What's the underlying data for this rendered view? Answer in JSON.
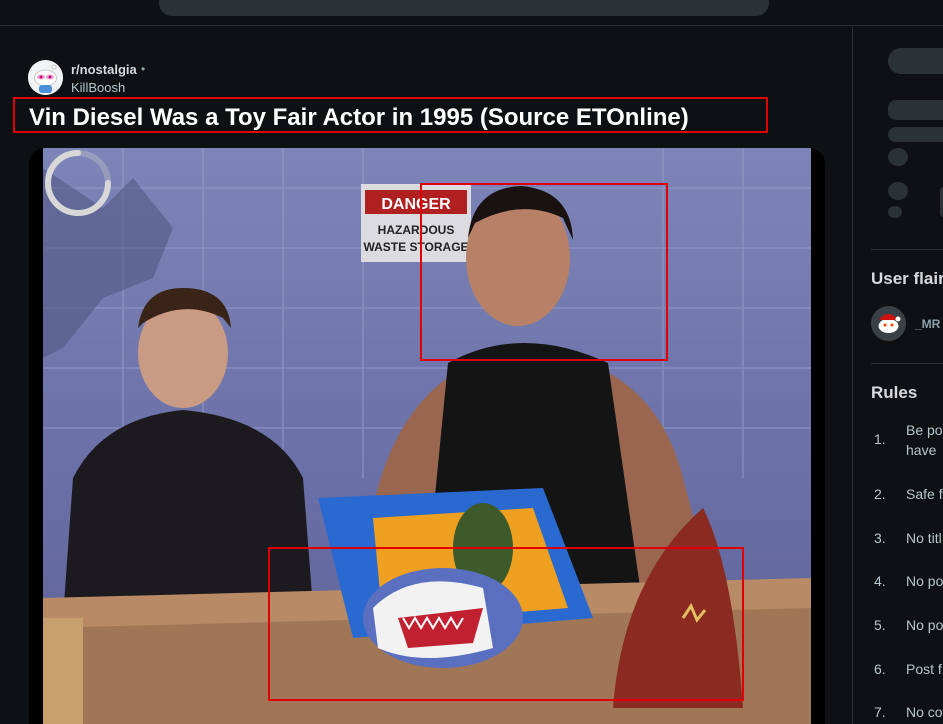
{
  "post": {
    "subreddit": "r/nostalgia",
    "separator": "•",
    "author": "KillBoosh",
    "title": "Vin Diesel Was a Toy Fair Actor in 1995 (Source ETOnline)"
  },
  "video": {
    "sign_top": "DANGER",
    "sign_line1": "HAZARDOUS",
    "sign_line2": "WASTE STORAGE",
    "state": "loading"
  },
  "sidebar": {
    "user_flair_title": "User flair",
    "flair_user": "_MR",
    "rules_title": "Rules",
    "rules": [
      {
        "num": "1.",
        "line1": "Be po",
        "line2": "have"
      },
      {
        "num": "2.",
        "line1": "Safe f",
        "line2": ""
      },
      {
        "num": "3.",
        "line1": "No titl",
        "line2": ""
      },
      {
        "num": "4.",
        "line1": "No po",
        "line2": ""
      },
      {
        "num": "5.",
        "line1": "No po",
        "line2": ""
      },
      {
        "num": "6.",
        "line1": "Post f",
        "line2": ""
      },
      {
        "num": "7.",
        "line1": "No co",
        "line2": ""
      }
    ]
  },
  "colors": {
    "background": "#0e1113",
    "highlight": "#e00000",
    "skeleton": "#2a3236"
  }
}
